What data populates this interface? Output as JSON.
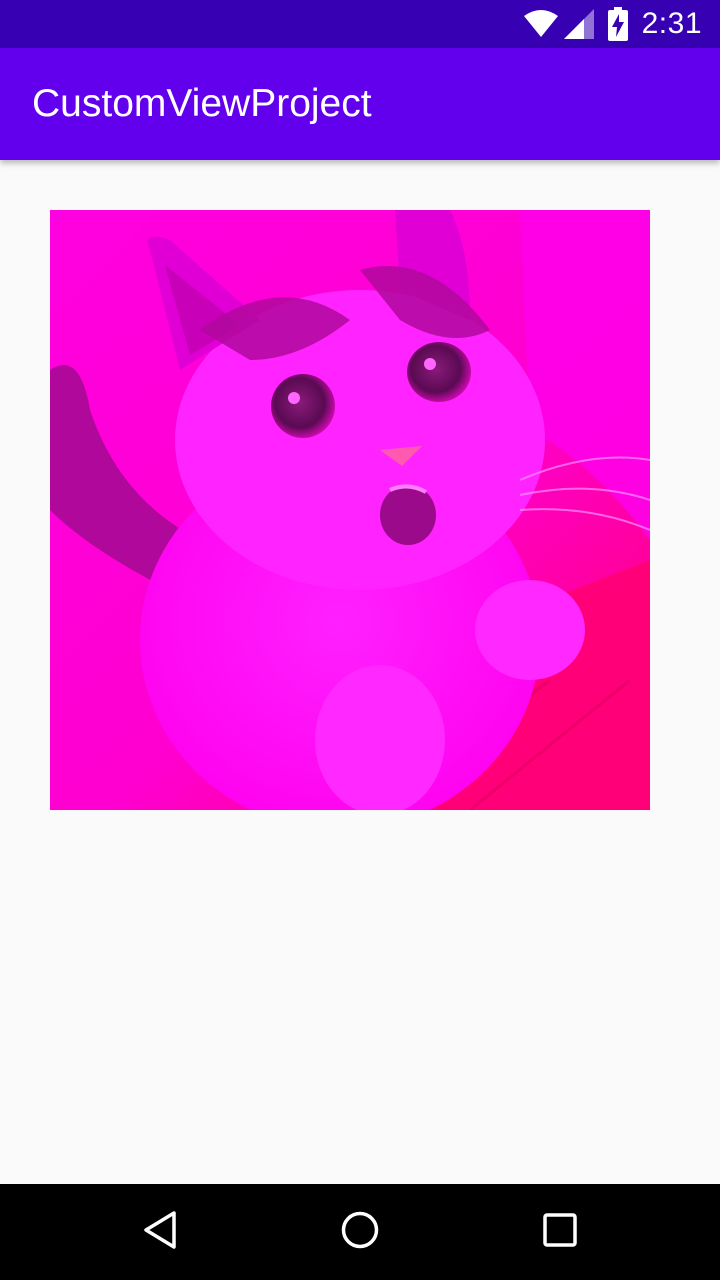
{
  "status_bar": {
    "time": "2:31",
    "icons": [
      "wifi-icon",
      "cell-signal-icon",
      "battery-charging-icon"
    ],
    "background_color": "#3700b3"
  },
  "app_bar": {
    "title": "CustomViewProject",
    "background_color": "#6200ee",
    "title_color": "#ffffff"
  },
  "content": {
    "image": {
      "subject": "kitten photo with magenta color filter",
      "tint_color": "#ff00ff"
    }
  },
  "nav_bar": {
    "buttons": [
      "back-icon",
      "home-icon",
      "recents-icon"
    ]
  }
}
